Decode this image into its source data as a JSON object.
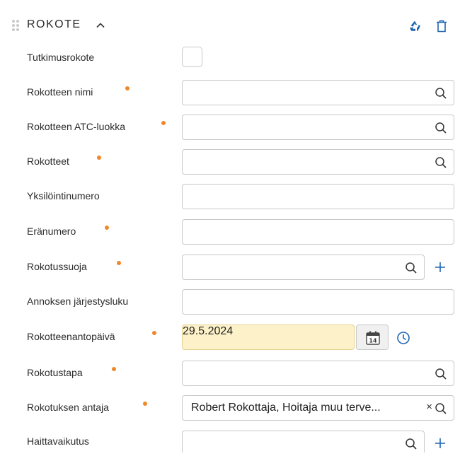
{
  "section": {
    "title": "ROKOTE",
    "collapse_icon": "chevron-up-icon",
    "actions": [
      {
        "icon": "recycle-icon",
        "color": "#1f66b3"
      },
      {
        "icon": "trash-icon",
        "color": "#1f66b3"
      }
    ]
  },
  "accent_color": "#1f66b3",
  "required_color": "#f0872a",
  "fields": {
    "tutkimusrokote": {
      "label": "Tutkimusrokote",
      "checked": false
    },
    "rokotteen_nimi": {
      "label": "Rokotteen nimi",
      "required": true,
      "value": ""
    },
    "rokotteen_atc": {
      "label": "Rokotteen ATC-luokka",
      "required": true,
      "value": ""
    },
    "rokotteet": {
      "label": "Rokotteet",
      "required": true,
      "value": ""
    },
    "yksilointinumero": {
      "label": "Yksilöintinumero",
      "value": ""
    },
    "eranumero": {
      "label": "Eränumero",
      "required": true,
      "value": ""
    },
    "rokotussuoja": {
      "label": "Rokotussuoja",
      "required": true,
      "value": ""
    },
    "annoksen_jarjestysluku": {
      "label": "Annoksen järjestysluku",
      "value": ""
    },
    "rokotteenantopaiva": {
      "label": "Rokotteenantopäivä",
      "required": true,
      "value": "29.5.2024",
      "calendar_day": "14"
    },
    "rokotustapa": {
      "label": "Rokotustapa",
      "required": true,
      "value": ""
    },
    "rokotuksen_antaja": {
      "label": "Rokotuksen antaja",
      "required": true,
      "value": "Robert Rokottaja, Hoitaja muu terve...",
      "clear_glyph": "×"
    },
    "haittavaikutus": {
      "label": "Haittavaikutus",
      "value": ""
    }
  }
}
